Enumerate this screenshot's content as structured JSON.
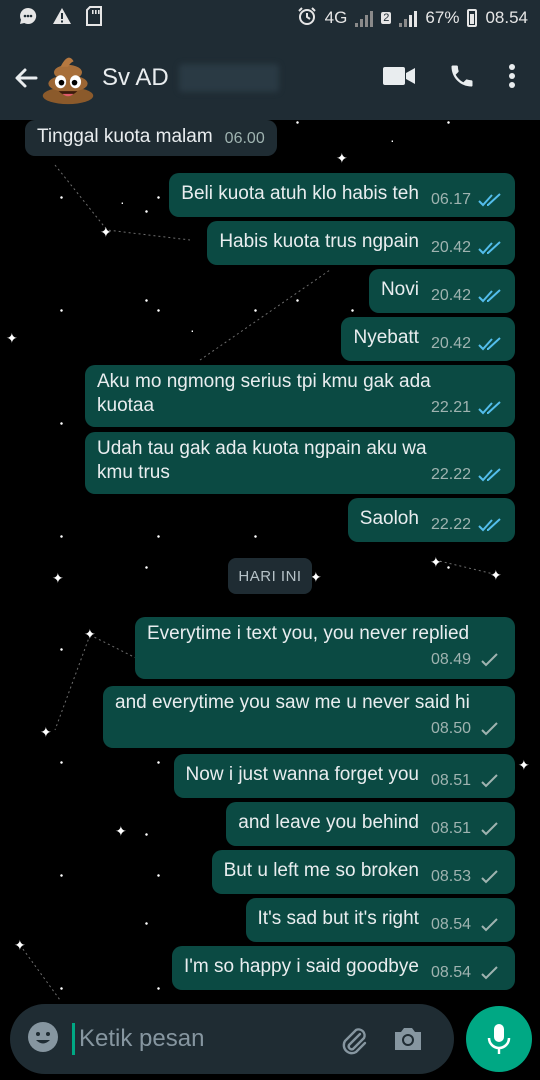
{
  "status_bar": {
    "network": "4G",
    "sim_slot": "2",
    "battery": "67%",
    "time": "08.54"
  },
  "header": {
    "contact_name": "Sv AD"
  },
  "date_divider": "HARI INI",
  "messages": [
    {
      "dir": "in",
      "text": "Tinggal kuota malam",
      "time": "06.00"
    },
    {
      "dir": "out",
      "text": "Beli kuota atuh klo habis teh",
      "time": "06.17",
      "status": "read"
    },
    {
      "dir": "out",
      "text": "Habis kuota trus ngpain",
      "time": "20.42",
      "status": "read"
    },
    {
      "dir": "out",
      "text": "Novi",
      "time": "20.42",
      "status": "read"
    },
    {
      "dir": "out",
      "text": "Nyebatt",
      "time": "20.42",
      "status": "read"
    },
    {
      "dir": "out",
      "text": "Aku mo ngmong serius tpi kmu gak ada kuotaa",
      "time": "22.21",
      "status": "read"
    },
    {
      "dir": "out",
      "text": "Udah tau gak ada kuota ngpain aku wa kmu trus",
      "time": "22.22",
      "status": "read"
    },
    {
      "dir": "out",
      "text": "Saoloh",
      "time": "22.22",
      "status": "read"
    },
    {
      "dir": "out",
      "text": "Everytime i text you, you never replied",
      "time": "08.49",
      "status": "sent"
    },
    {
      "dir": "out",
      "text": "and everytime you saw me u never said hi",
      "time": "08.50",
      "status": "sent"
    },
    {
      "dir": "out",
      "text": "Now i just wanna forget you",
      "time": "08.51",
      "status": "sent"
    },
    {
      "dir": "out",
      "text": "and leave you behind",
      "time": "08.51",
      "status": "sent"
    },
    {
      "dir": "out",
      "text": "But u left me so broken",
      "time": "08.53",
      "status": "sent"
    },
    {
      "dir": "out",
      "text": "It's sad but it's right",
      "time": "08.54",
      "status": "sent"
    },
    {
      "dir": "out",
      "text": "I'm so happy i said goodbye",
      "time": "08.54",
      "status": "sent"
    }
  ],
  "composer": {
    "placeholder": "Ketik pesan"
  },
  "colors": {
    "header_bg": "#1f2c34",
    "outgoing_bubble": "#0b4a43",
    "incoming_bubble": "#1f2c33",
    "accent": "#00a884",
    "read_tick": "#53bdeb"
  },
  "icons": [
    "back-arrow-icon",
    "poop-emoji-avatar",
    "video-call-icon",
    "phone-icon",
    "more-vert-icon",
    "emoji-icon",
    "attach-icon",
    "camera-icon",
    "mic-icon"
  ]
}
